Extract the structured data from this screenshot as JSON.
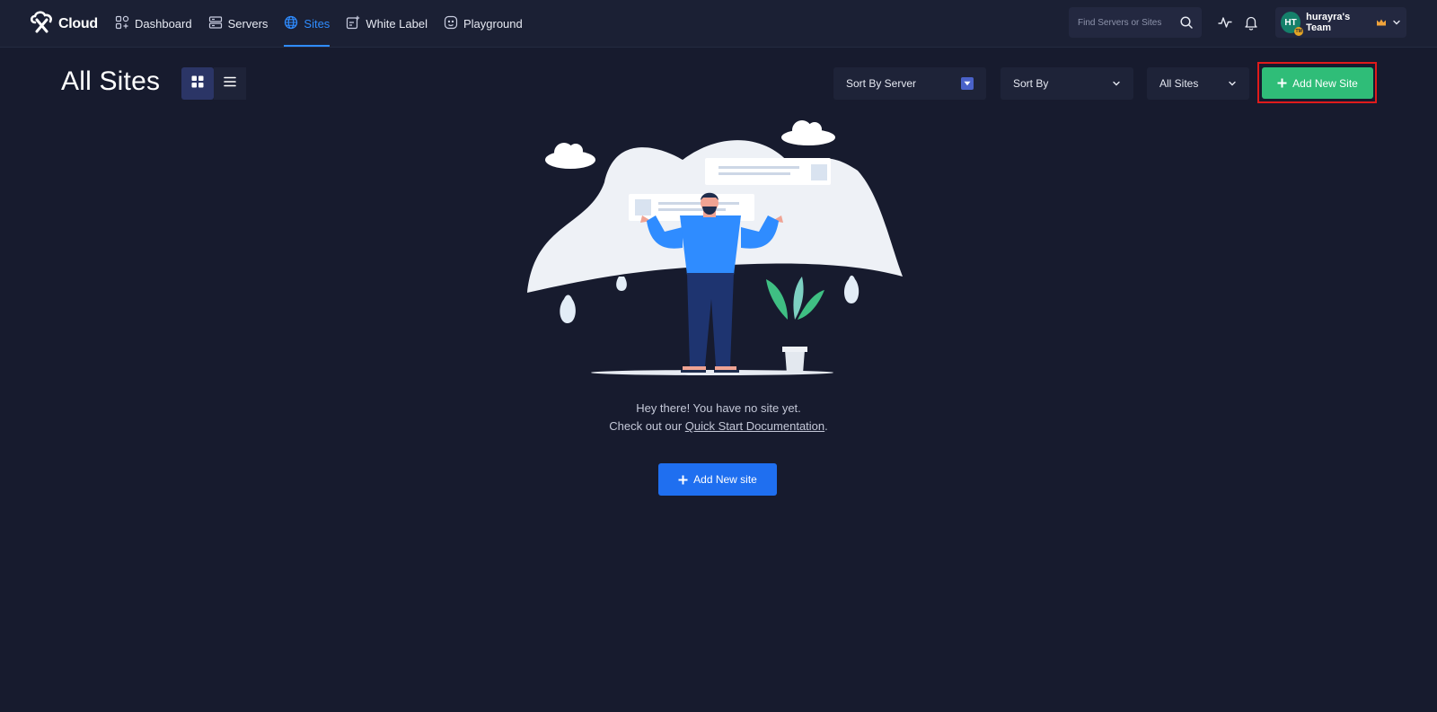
{
  "brand": {
    "name": "Cloud",
    "logo_icon": "x-cloud-logo-icon"
  },
  "nav": [
    {
      "label": "Dashboard",
      "icon": "dashboard-icon",
      "active": false
    },
    {
      "label": "Servers",
      "icon": "servers-icon",
      "active": false
    },
    {
      "label": "Sites",
      "icon": "globe-icon",
      "active": true
    },
    {
      "label": "White Label",
      "icon": "white-label-icon",
      "active": false
    },
    {
      "label": "Playground",
      "icon": "playground-icon",
      "active": false
    }
  ],
  "search": {
    "placeholder": "Find Servers or Sites"
  },
  "team": {
    "initials": "HT",
    "badge": "TM",
    "name": "hurayra's Team"
  },
  "page": {
    "title": "All Sites"
  },
  "filters": {
    "sort_by_server": "Sort By Server",
    "sort_by": "Sort By",
    "all_sites": "All Sites"
  },
  "actions": {
    "add_new_site": "Add New Site"
  },
  "empty_state": {
    "line1": "Hey there! You have no site yet.",
    "line2_prefix": "Check out our ",
    "link_text": "Quick Start Documentation",
    "line2_suffix": ".",
    "button": "Add New site"
  },
  "colors": {
    "background": "#171b2e",
    "accent_blue": "#2f8cff",
    "add_green": "#2fbd78",
    "highlight_red": "#e01b1b",
    "primary_button": "#1f6ff0"
  }
}
